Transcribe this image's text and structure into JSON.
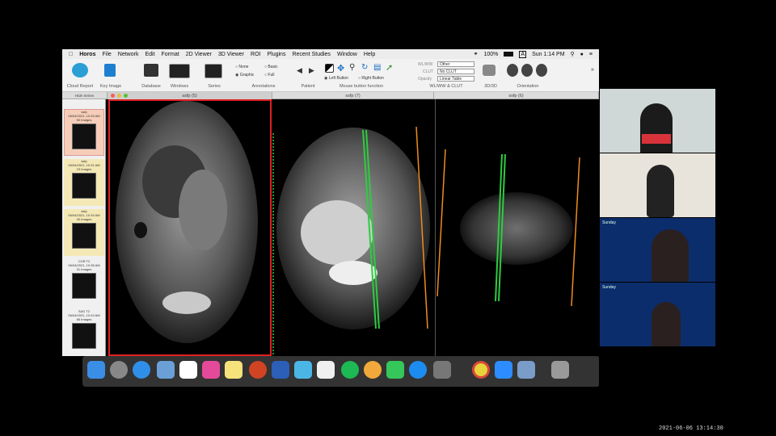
{
  "menubar": {
    "apple": "",
    "app": "Horos",
    "items": [
      "File",
      "Network",
      "Edit",
      "Format",
      "2D Viewer",
      "3D Viewer",
      "ROI",
      "Plugins",
      "Recent Studies",
      "Window",
      "Help"
    ],
    "battery": "100%",
    "input": "A",
    "clock": "Sun 1:14 PM"
  },
  "toolbar": {
    "cloud": "Cloud Report",
    "keyimage": "Key Image",
    "database": "Database",
    "windows": "Windows",
    "series": "Series",
    "annotations": "Annotations",
    "none": "None",
    "basic": "Basic",
    "graphic": "Graphic",
    "full": "Full",
    "patient": "Patient",
    "mouse": "Mouse button function",
    "left": "Left Button",
    "right": "Right Button",
    "wlww_label": "WL/WW",
    "wlww_val": "Other",
    "clut_label": "CLUT",
    "clut_val": "No CLUT",
    "opacity_label": "Opacity",
    "opacity_val": "Linear Table",
    "wlww_clut": "WL/WW & CLUT",
    "threed": "3D/3D",
    "orientation": "Orientation"
  },
  "tabs": [
    "ssfp (5)",
    "ssfp (7)",
    "ssfp (6)"
  ],
  "sidebar": {
    "title": "Hide Series",
    "items": [
      {
        "name": "ssfp",
        "date": "06/04/2021, 10:25 AM",
        "count": "50 Images"
      },
      {
        "name": "ssfp",
        "date": "06/04/2021, 10:31 AM",
        "count": "23 Images"
      },
      {
        "name": "ssfp",
        "date": "06/04/2021, 10:34 AM",
        "count": "30 Images"
      },
      {
        "name": "COR T2",
        "date": "06/04/2021, 10:38 AM",
        "count": "31 Images"
      },
      {
        "name": "SAG T2",
        "date": "06/04/2021, 10:43 AM",
        "count": "56 Images"
      }
    ]
  },
  "participants": [
    "",
    "",
    "Sunday",
    "Sunday"
  ],
  "timestamp": "2021-06-06  13:14:30",
  "colors": {
    "active_border": "#e02020",
    "ref_line_green": "#2ecc40",
    "ref_line_orange": "#f08c1e"
  }
}
